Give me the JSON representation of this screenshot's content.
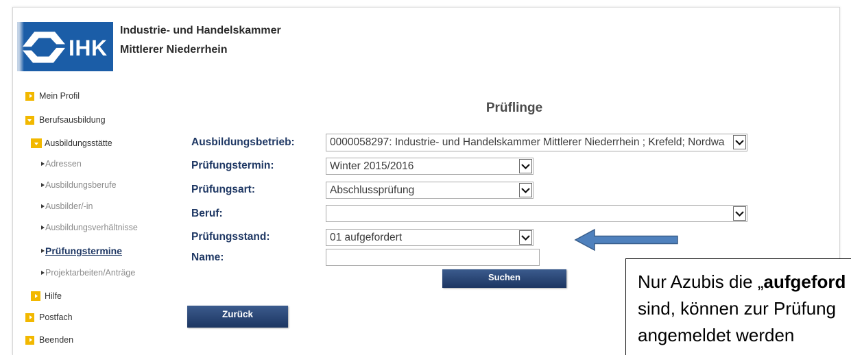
{
  "header": {
    "logo_text": "IHK",
    "logo_icon": "ihk-emblem-icon",
    "org_line1": "Industrie- und Handelskammer",
    "org_line2": "Mittlerer Niederrhein"
  },
  "sidebar": {
    "items": [
      {
        "label": "Mein Profil",
        "icon": "yellow-arrow-right-icon"
      },
      {
        "label": "Berufsausbildung",
        "icon": "yellow-arrow-down-icon"
      },
      {
        "label": "Ausbildungsstätte",
        "icon": "yellow-arrow-down-icon"
      },
      {
        "label": "Adressen",
        "icon": "triangle-right-icon"
      },
      {
        "label": "Ausbildungsberufe",
        "icon": "triangle-right-icon"
      },
      {
        "label": "Ausbilder/-in",
        "icon": "triangle-right-icon"
      },
      {
        "label": "Ausbildungsverhältnisse",
        "icon": "triangle-right-icon"
      },
      {
        "label": "Prüfungstermine",
        "icon": "triangle-right-icon",
        "active": true
      },
      {
        "label": "Projektarbeiten/Anträge",
        "icon": "triangle-right-icon"
      },
      {
        "label": "Hilfe",
        "icon": "yellow-arrow-right-icon"
      },
      {
        "label": "Postfach",
        "icon": "yellow-arrow-right-icon"
      },
      {
        "label": "Beenden",
        "icon": "yellow-arrow-right-icon"
      }
    ]
  },
  "main": {
    "title": "Prüflinge",
    "fields": [
      {
        "label": "Ausbildungsbetrieb:",
        "value": "0000058297: Industrie- und Handelskammer Mittlerer Niederrhein ; Krefeld; Nordwa"
      },
      {
        "label": "Prüfungstermin:",
        "value": "Winter 2015/2016"
      },
      {
        "label": "Prüfungsart:",
        "value": "Abschlussprüfung"
      },
      {
        "label": "Beruf:",
        "value": ""
      },
      {
        "label": "Prüfungsstand:",
        "value": "01 aufgefordert"
      },
      {
        "label": "Name:",
        "value": ""
      }
    ],
    "dropdown_icon": "chevron-down-icon",
    "search_button": "Suchen",
    "back_button": "Zurück"
  },
  "annotation": {
    "arrow_icon": "arrow-left-icon",
    "callout": {
      "line1_prefix": "Nur Azubis die „",
      "line1_bold": "aufgeford",
      "line2": "sind, können zur Prüfung",
      "line3": "angemeldet werden"
    }
  },
  "colors": {
    "nav_yellow": "#f2b800",
    "label_navy": "#1f3864",
    "button_top": "#3b5b8d",
    "button_bottom": "#1c3561",
    "logo_blue": "#1b5da7",
    "arrow_fill": "#4f81bd",
    "arrow_stroke": "#385d8a"
  }
}
